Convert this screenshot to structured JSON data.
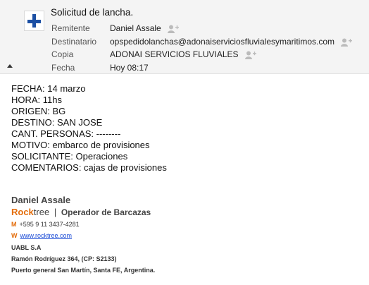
{
  "email": {
    "subject": "Solicitud de lancha.",
    "fields": {
      "from": {
        "label": "Remitente",
        "value": "Daniel Assale"
      },
      "to": {
        "label": "Destinatario",
        "value": "opspedidolanchas@adonaiserviciosfluvialesymaritimos.com"
      },
      "cc": {
        "label": "Copia",
        "value": "ADONAI SERVICIOS FLUVIALES"
      },
      "date": {
        "label": "Fecha",
        "value": "Hoy 08:17"
      }
    }
  },
  "body": {
    "lines": [
      "FECHA: 14 marzo",
      "HORA: 11hs",
      "ORIGEN: BG",
      "DESTINO: SAN JOSE",
      "CANT. PERSONAS: --------",
      "MOTIVO: embarco de provisiones",
      "SOLICITANTE: Operaciones",
      "COMENTARIOS: cajas de provisiones"
    ]
  },
  "signature": {
    "name": "Daniel Assale",
    "brand_rock": "Rock",
    "brand_tree": "tree",
    "separator": "|",
    "role": "Operador de Barcazas",
    "phone_letter": "M",
    "phone": "+595 9 11 3437-4281",
    "web_letter": "W",
    "web": "www.rocktree.com",
    "company": "UABL S.A",
    "address1": "Ramón Rodríguez 364, (CP: S2133)",
    "address2": "Puerto general San Martín, Santa FE, Argentina."
  },
  "colors": {
    "accent_orange": "#e36c0a",
    "logo_blue": "#1b4fa3",
    "link_blue": "#1a4bd6"
  },
  "icons": [
    "sender-avatar-icon",
    "add-contact-icon",
    "collapse-icon"
  ]
}
